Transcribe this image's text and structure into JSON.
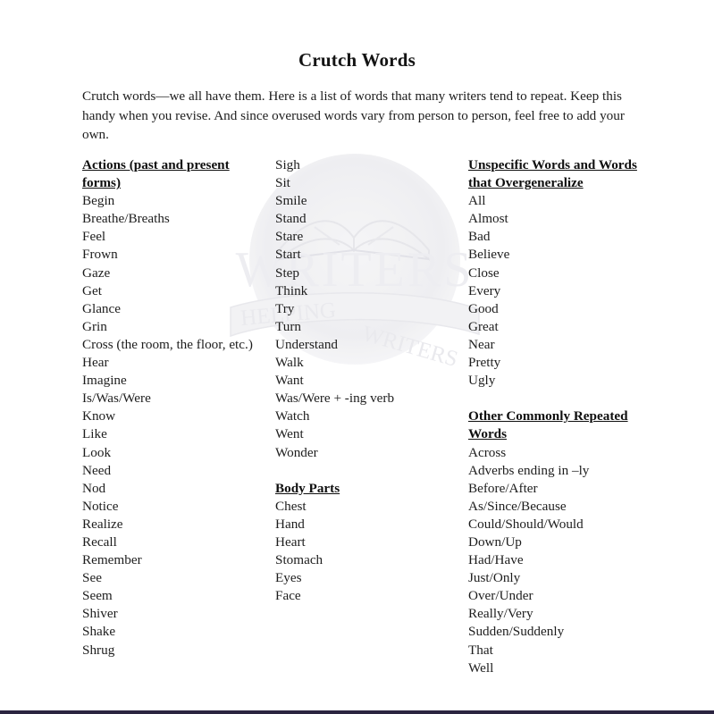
{
  "document": {
    "title": "Crutch Words",
    "intro": "Crutch words—we all have them. Here is a list of words that many writers tend to repeat. Keep this handy when you revise. And since overused words vary from person to person, feel free to add your own.",
    "watermark": {
      "main_text": "WRITERS",
      "banner_text_left": "HELPING",
      "banner_text_right": "WRITERS",
      "emblem": "open-book",
      "color": "#e9e9ec"
    },
    "bottom_rule_color": "#2b2440",
    "page_background": "#ffffff",
    "text_color": "#1d1d1d"
  },
  "columns": [
    {
      "id": "column-1",
      "blocks": [
        {
          "heading": "Actions (past and present forms)",
          "items": [
            "Begin",
            "Breathe/Breaths",
            "Feel",
            "Frown",
            "Gaze",
            "Get",
            "Glance",
            "Grin",
            "Cross (the room, the floor, etc.)",
            "Hear",
            "Imagine",
            "Is/Was/Were",
            "Know",
            "Like",
            "Look",
            "Need",
            "Nod",
            "Notice",
            "Realize",
            "Recall",
            "Remember",
            "See",
            "Seem",
            "Shiver",
            "Shake",
            "Shrug"
          ]
        }
      ]
    },
    {
      "id": "column-2",
      "blocks": [
        {
          "heading": "",
          "items": [
            "Sigh",
            "Sit",
            "Smile",
            "Stand",
            "Stare",
            "Start",
            "Step",
            "Think",
            "Try",
            "Turn",
            "Understand",
            "Walk",
            "Want",
            "Was/Were + -ing verb",
            "Watch",
            "Went",
            "Wonder"
          ]
        },
        {
          "heading": "Body Parts",
          "items": [
            "Chest",
            "Hand",
            "Heart",
            "Stomach",
            "Eyes",
            "Face"
          ]
        }
      ]
    },
    {
      "id": "column-3",
      "blocks": [
        {
          "heading": "Unspecific Words and Words that Overgeneralize",
          "items": [
            "All",
            "Almost",
            "Bad",
            "Believe",
            "Close",
            "Every",
            "Good",
            "Great",
            "Near",
            "Pretty",
            "Ugly"
          ]
        },
        {
          "heading": "Other Commonly Repeated Words",
          "items": [
            "Across",
            "Adverbs ending in –ly",
            "Before/After",
            "As/Since/Because",
            "Could/Should/Would",
            "Down/Up",
            "Had/Have",
            "Just/Only",
            "Over/Under",
            "Really/Very",
            "Sudden/Suddenly",
            "That",
            "Well"
          ]
        }
      ]
    }
  ]
}
